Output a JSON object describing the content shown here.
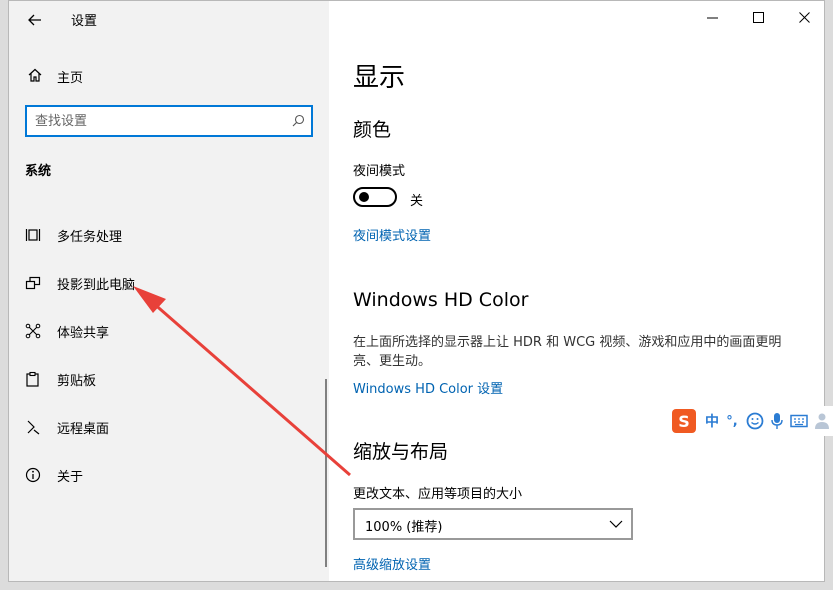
{
  "window": {
    "title": "设置",
    "caption_buttons": [
      "minimize",
      "maximize",
      "close"
    ]
  },
  "sidebar": {
    "home_label": "主页",
    "search_placeholder": "查找设置",
    "section_label": "系统",
    "items": [
      {
        "label": "多任务处理",
        "icon": "multitasking-icon"
      },
      {
        "label": "投影到此电脑",
        "icon": "project-icon"
      },
      {
        "label": "体验共享",
        "icon": "shared-experiences-icon"
      },
      {
        "label": "剪贴板",
        "icon": "clipboard-icon"
      },
      {
        "label": "远程桌面",
        "icon": "remote-desktop-icon"
      },
      {
        "label": "关于",
        "icon": "info-icon"
      }
    ]
  },
  "main": {
    "title": "显示",
    "color_section": {
      "heading": "颜色",
      "night_mode_label": "夜间模式",
      "night_mode_state": "关",
      "night_mode_on": false,
      "night_mode_link": "夜间模式设置"
    },
    "hd_section": {
      "heading": "Windows HD Color",
      "description": "在上面所选择的显示器上让 HDR 和 WCG 视频、游戏和应用中的画面更明亮、更生动。",
      "link": "Windows HD Color 设置"
    },
    "scale_section": {
      "heading": "缩放与布局",
      "label": "更改文本、应用等项目的大小",
      "selected_value": "100% (推荐)",
      "advanced_link": "高级缩放设置"
    }
  },
  "ime_toolbar": {
    "logo": "S",
    "mode": "中",
    "punctuation": "°,",
    "icons": [
      "emoji-icon",
      "microphone-icon",
      "keyboard-icon",
      "user-icon"
    ]
  },
  "colors": {
    "accent": "#0078d7",
    "link": "#0063b1",
    "sidebar_bg": "#f2f2f2",
    "annotation_arrow": "#e8413a",
    "ime_logo": "#f05a22",
    "ime_icons": "#2b7cd3"
  }
}
